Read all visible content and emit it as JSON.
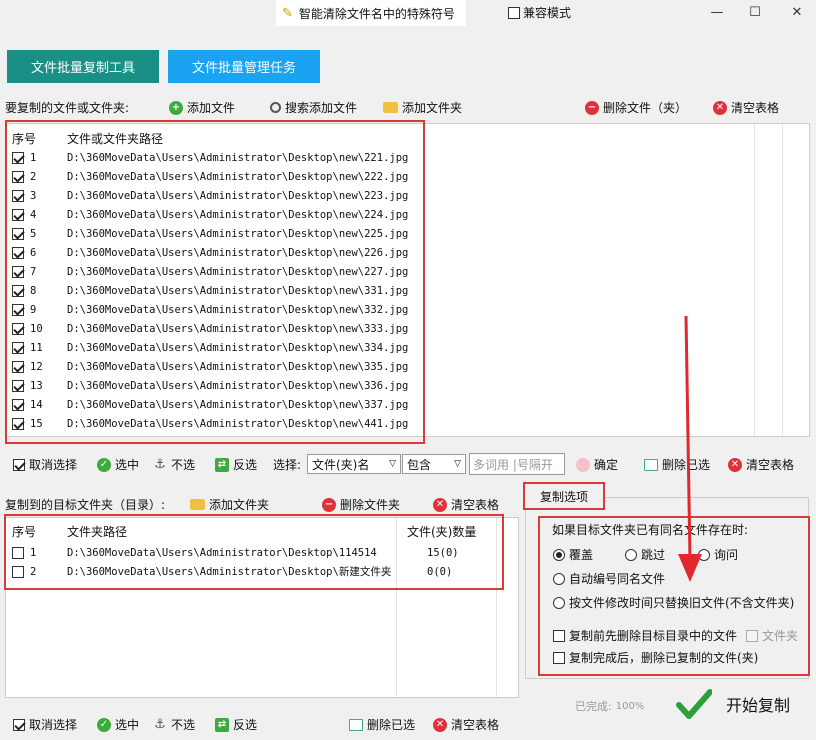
{
  "titlebar": {
    "title": "智能清除文件名中的特殊符号",
    "compat_label": "兼容模式",
    "compat_checked": false,
    "minimize": "—",
    "maximize": "☐",
    "close": "✕"
  },
  "tabs": {
    "copy_tool": "文件批量复制工具",
    "manage": "文件批量管理任务"
  },
  "source": {
    "section_label": "要复制的文件或文件夹:",
    "add_file": "添加文件",
    "search_add_file": "搜索添加文件",
    "add_folder": "添加文件夹",
    "delete_file": "删除文件（夹）",
    "clear_table": "清空表格",
    "col_index": "序号",
    "col_path": "文件或文件夹路径",
    "rows": [
      {
        "index": "1",
        "path": "D:\\360MoveData\\Users\\Administrator\\Desktop\\new\\221.jpg"
      },
      {
        "index": "2",
        "path": "D:\\360MoveData\\Users\\Administrator\\Desktop\\new\\222.jpg"
      },
      {
        "index": "3",
        "path": "D:\\360MoveData\\Users\\Administrator\\Desktop\\new\\223.jpg"
      },
      {
        "index": "4",
        "path": "D:\\360MoveData\\Users\\Administrator\\Desktop\\new\\224.jpg"
      },
      {
        "index": "5",
        "path": "D:\\360MoveData\\Users\\Administrator\\Desktop\\new\\225.jpg"
      },
      {
        "index": "6",
        "path": "D:\\360MoveData\\Users\\Administrator\\Desktop\\new\\226.jpg"
      },
      {
        "index": "7",
        "path": "D:\\360MoveData\\Users\\Administrator\\Desktop\\new\\227.jpg"
      },
      {
        "index": "8",
        "path": "D:\\360MoveData\\Users\\Administrator\\Desktop\\new\\331.jpg"
      },
      {
        "index": "9",
        "path": "D:\\360MoveData\\Users\\Administrator\\Desktop\\new\\332.jpg"
      },
      {
        "index": "10",
        "path": "D:\\360MoveData\\Users\\Administrator\\Desktop\\new\\333.jpg"
      },
      {
        "index": "11",
        "path": "D:\\360MoveData\\Users\\Administrator\\Desktop\\new\\334.jpg"
      },
      {
        "index": "12",
        "path": "D:\\360MoveData\\Users\\Administrator\\Desktop\\new\\335.jpg"
      },
      {
        "index": "13",
        "path": "D:\\360MoveData\\Users\\Administrator\\Desktop\\new\\336.jpg"
      },
      {
        "index": "14",
        "path": "D:\\360MoveData\\Users\\Administrator\\Desktop\\new\\337.jpg"
      },
      {
        "index": "15",
        "path": "D:\\360MoveData\\Users\\Administrator\\Desktop\\new\\441.jpg"
      }
    ]
  },
  "src_bottom": {
    "deselect": "取消选择",
    "select": "选中",
    "unselect": "不选",
    "invert": "反选",
    "choose_label": "选择:",
    "choose_value": "文件(夹)名",
    "match_value": "包含",
    "keyword_placeholder": "多词用 |号隔开",
    "confirm": "确定",
    "delete_selected": "删除已选",
    "clear_table": "清空表格"
  },
  "target": {
    "section_label": "复制到的目标文件夹（目录）:",
    "add_folder": "添加文件夹",
    "delete_folder": "删除文件夹",
    "clear_table": "清空表格",
    "col_index": "序号",
    "col_path": "文件夹路径",
    "col_count": "文件(夹)数量",
    "rows": [
      {
        "index": "1",
        "path": "D:\\360MoveData\\Users\\Administrator\\Desktop\\114514",
        "count": "15(0)"
      },
      {
        "index": "2",
        "path": "D:\\360MoveData\\Users\\Administrator\\Desktop\\新建文件夹",
        "count": "0(0)"
      }
    ]
  },
  "options": {
    "tab_label": "复制选项",
    "exists_label": "如果目标文件夹已有同名文件存在时:",
    "overwrite": "覆盖",
    "skip": "跳过",
    "ask": "询问",
    "auto_number": "自动编号同名文件",
    "by_mtime": "按文件修改时间只替换旧文件(不含文件夹)",
    "delete_before": "复制前先删除目标目录中的文件",
    "folder": "文件夹",
    "delete_after": "复制完成后，删除已复制的文件(夹)"
  },
  "progress": {
    "done_label": "已完成:",
    "percent_text": "100%",
    "percent": 100,
    "start_copy": "开始复制"
  },
  "tgt_bottom": {
    "deselect": "取消选择",
    "select": "选中",
    "unselect": "不选",
    "invert": "反选",
    "delete_selected": "删除已选",
    "clear_table": "清空表格"
  },
  "colors": {
    "tab_copy": "#1a8f86",
    "tab_manage": "#1aa3f0",
    "highlight_red": "#d93b3b",
    "check_green": "#2e9e3a"
  }
}
